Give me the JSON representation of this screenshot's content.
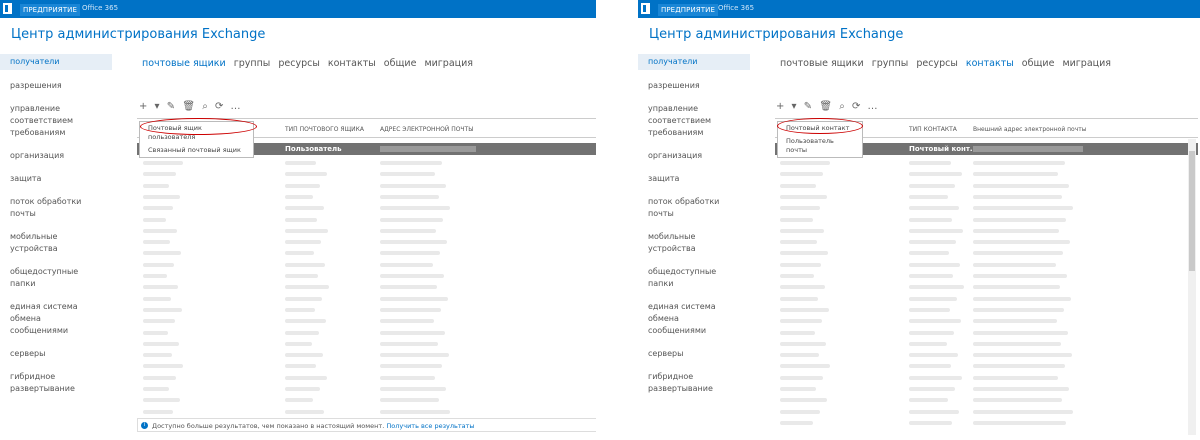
{
  "left": {
    "topbar": {
      "enterprise": "ПРЕДПРИЯТИЕ",
      "office": "Office 365"
    },
    "title": "Центр администрирования Exchange",
    "nav": [
      "получатели",
      "разрешения",
      "управление соответствием требованиям",
      "организация",
      "защита",
      "поток обработки почты",
      "мобильные устройства",
      "общедоступные папки",
      "единая система обмена сообщениями",
      "серверы",
      "гибридное развертывание"
    ],
    "tabs": [
      "почтовые ящики",
      "группы",
      "ресурсы",
      "контакты",
      "общие",
      "миграция"
    ],
    "toolbar": "+ ▾ ✎ 🗑 ⌕ ⟳ …",
    "headers": [
      "ТИП ПОЧТОВОГО ЯЩИКА",
      "АДРЕС ЭЛЕКТРОННОЙ ПОЧТЫ"
    ],
    "dropdown": [
      "Почтовый ящик пользователя",
      "Связанный почтовый ящик"
    ],
    "selected_type": "Пользователь",
    "status_msg": "Доступно больше результатов, чем показано в настоящий момент.",
    "status_link": "Получить все результаты"
  },
  "right": {
    "topbar": {
      "enterprise": "ПРЕДПРИЯТИЕ",
      "office": "Office 365"
    },
    "title": "Центр администрирования Exchange",
    "nav": [
      "получатели",
      "разрешения",
      "управление соответствием требованиям",
      "организация",
      "защита",
      "поток обработки почты",
      "мобильные устройства",
      "общедоступные папки",
      "единая система обмена сообщениями",
      "серверы",
      "гибридное развертывание"
    ],
    "tabs": [
      "почтовые ящики",
      "группы",
      "ресурсы",
      "контакты",
      "общие",
      "миграция"
    ],
    "toolbar": "+ ▾ ✎ 🗑 ⌕ ⟳ …",
    "headers": [
      "ТИП КОНТАКТА",
      "Внешний адрес электронной почты"
    ],
    "dropdown": [
      "Почтовый контакт",
      "Пользователь почты"
    ],
    "selected_type": "Почтовый конт..."
  },
  "colors": {
    "accent": "#0072c6",
    "topbar": "#0072c6",
    "highlight": "#c00000"
  },
  "icons": [
    "office-logo-icon",
    "add-icon",
    "edit-icon",
    "delete-icon",
    "search-icon",
    "refresh-icon",
    "more-icon",
    "info-icon",
    "scroll-up-icon",
    "scroll-down-icon"
  ]
}
